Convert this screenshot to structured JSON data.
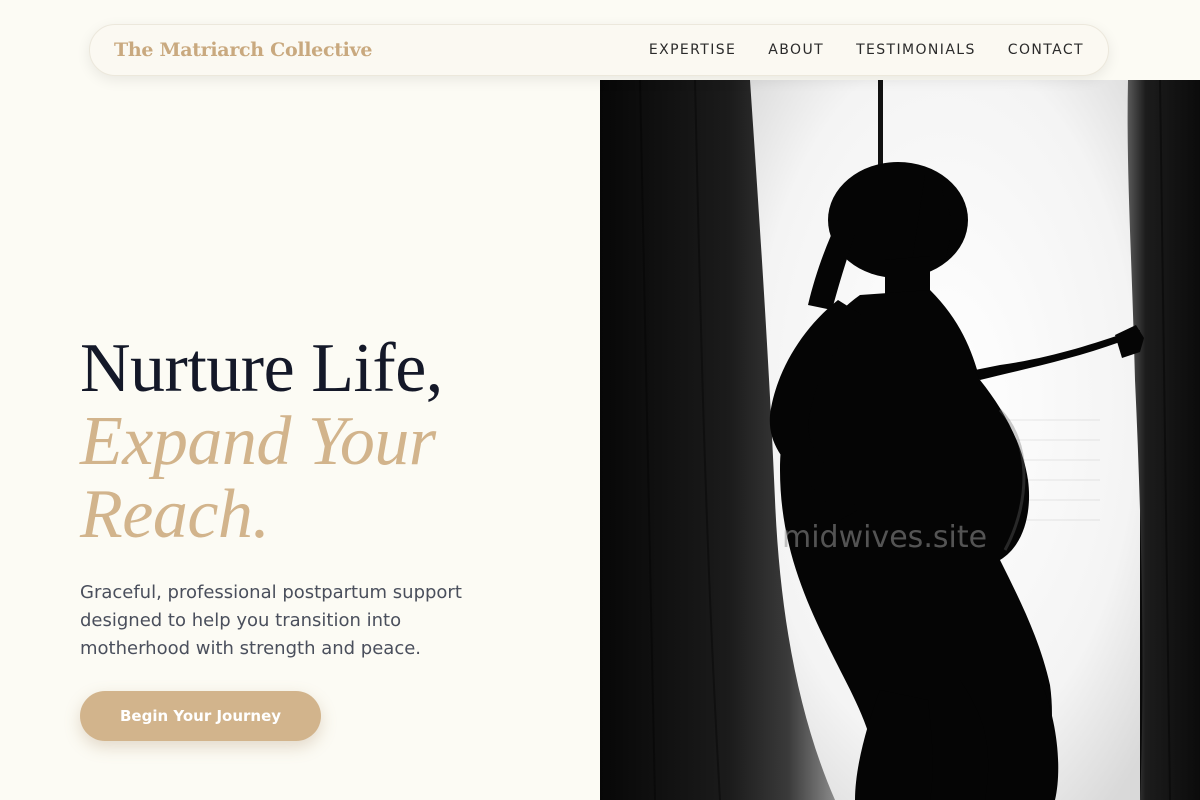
{
  "nav": {
    "brand": "The Matriarch Collective",
    "links": [
      "EXPERTISE",
      "ABOUT",
      "TESTIMONIALS",
      "CONTACT"
    ]
  },
  "hero": {
    "headline_line1": "Nurture Life,",
    "headline_line2": "Expand Your",
    "headline_line3": "Reach.",
    "subtext": "Graceful, professional postpartum support designed to help you transition into motherhood with strength and peace.",
    "cta_label": "Begin Your Journey"
  },
  "image": {
    "watermark": "midwives.site"
  },
  "colors": {
    "background": "#fcfbf4",
    "accent": "#d2b48c",
    "heading": "#141828",
    "body_text": "#4a4f5c"
  }
}
